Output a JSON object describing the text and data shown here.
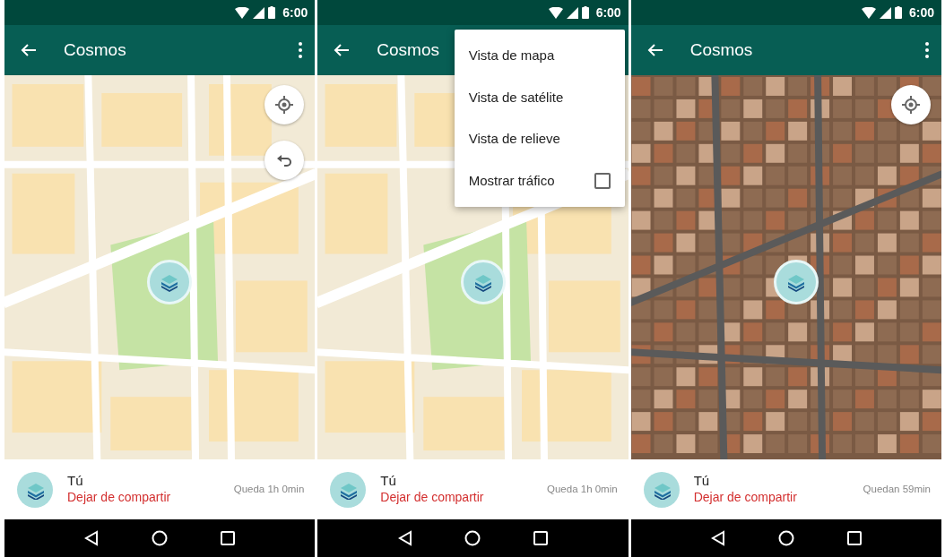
{
  "screens": [
    {
      "status_bar": {
        "time": "6:00"
      },
      "app_bar": {
        "title": "Cosmos"
      },
      "map": {
        "kind": "road",
        "buttons": [
          {
            "kind": "locate"
          },
          {
            "kind": "undo"
          }
        ]
      },
      "sharing": {
        "name": "Tú",
        "action": "Dejar de compartir",
        "remaining": "Queda 1h 0min"
      }
    },
    {
      "status_bar": {
        "time": "6:00"
      },
      "app_bar": {
        "title": "Cosmos"
      },
      "map": {
        "kind": "road"
      },
      "menu": [
        {
          "kind": "item",
          "label": "Vista de mapa"
        },
        {
          "kind": "item",
          "label": "Vista de satélite"
        },
        {
          "kind": "item",
          "label": "Vista de relieve"
        },
        {
          "kind": "checkbox",
          "label": "Mostrar tráfico",
          "checked": false
        }
      ],
      "sharing": {
        "name": "Tú",
        "action": "Dejar de compartir",
        "remaining": "Queda 1h 0min"
      }
    },
    {
      "status_bar": {
        "time": "6:00"
      },
      "app_bar": {
        "title": "Cosmos"
      },
      "map": {
        "kind": "satellite",
        "buttons": [
          {
            "kind": "locate"
          }
        ]
      },
      "sharing": {
        "name": "Tú",
        "action": "Dejar de compartir",
        "remaining": "Quedan 59min"
      }
    }
  ]
}
